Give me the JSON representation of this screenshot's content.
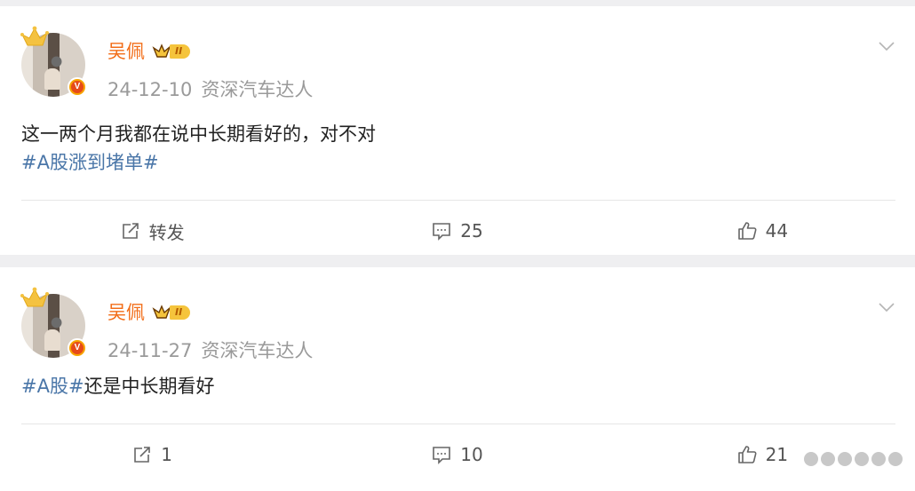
{
  "posts": [
    {
      "author": "吴佩",
      "vip_level": "II",
      "date": "24-12-10",
      "source": "资深汽车达人",
      "text": "这一两个月我都在说中长期看好的，对不对",
      "tag": "#A股涨到堵单#",
      "tail_text": "",
      "actions": {
        "repost": "转发",
        "comments": "25",
        "likes": "44"
      }
    },
    {
      "author": "吴佩",
      "vip_level": "II",
      "date": "24-11-27",
      "source": "资深汽车达人",
      "text": "",
      "tag": "#A股#",
      "tail_text": "还是中长期看好",
      "actions": {
        "repost": "1",
        "comments": "10",
        "likes": "21"
      }
    }
  ],
  "colors": {
    "author": "#f26d18",
    "tag": "#4a76a8",
    "verified": "#f7a400"
  },
  "icons": [
    "crown-icon",
    "verified-icon",
    "vip-icon",
    "chevron-down-icon",
    "repost-icon",
    "comment-icon",
    "like-icon"
  ]
}
